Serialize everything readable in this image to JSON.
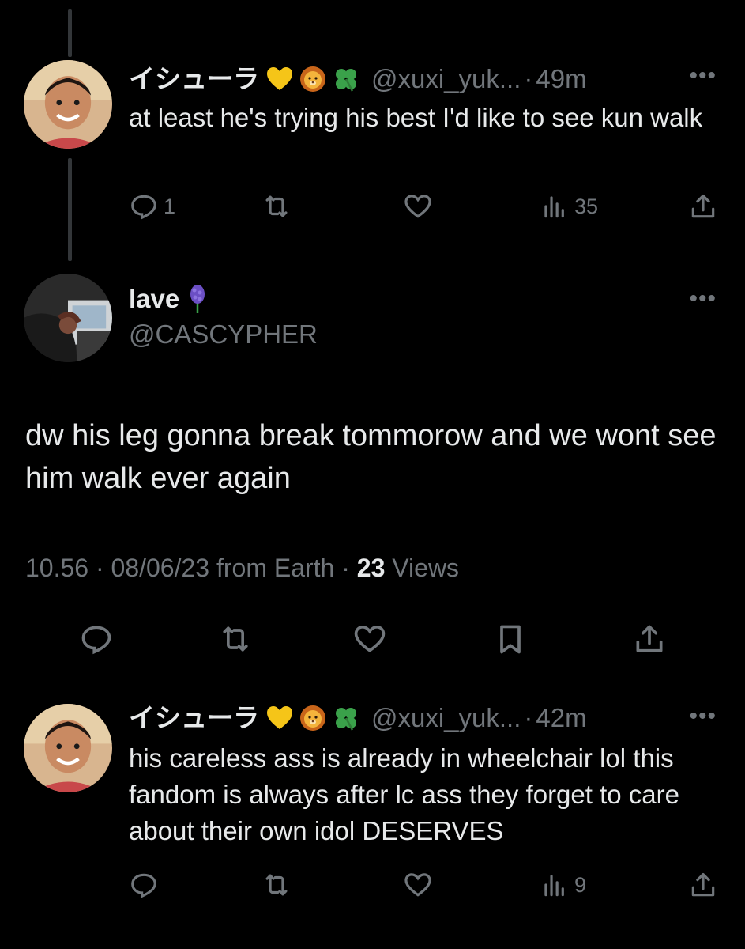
{
  "replies": [
    {
      "display_name": "イシューラ",
      "handle": "@xuxi_yuk...",
      "time": "49m",
      "text": "at least he's trying his best I'd like to see kun walk",
      "reply_count": "1",
      "retweet_count": "",
      "like_count": "",
      "views": "35"
    },
    {
      "display_name": "イシューラ",
      "handle": "@xuxi_yuk...",
      "time": "42m",
      "text": "his careless ass is already in wheelchair lol this fandom is always after lc ass they forget to care about their own idol DESERVES",
      "reply_count": "",
      "retweet_count": "",
      "like_count": "",
      "views": "9"
    }
  ],
  "main_tweet": {
    "display_name": "lave",
    "handle": "@CASCYPHER",
    "text": "dw his leg gonna break tommorow and we wont see him walk ever again",
    "timestamp": "10.56 · 08/06/23 from Earth · ",
    "views_count": "23",
    "views_label": " Views"
  },
  "ui": {
    "separator": "·",
    "more_glyph": "•••"
  },
  "icons": {
    "badges": [
      "yellow-heart-icon",
      "lion-icon",
      "four-leaf-clover-icon"
    ],
    "main_badge": "hyacinth-icon",
    "actions": [
      "reply-icon",
      "retweet-icon",
      "like-icon",
      "views-icon",
      "share-icon"
    ],
    "main_actions": [
      "reply-icon",
      "retweet-icon",
      "like-icon",
      "bookmark-icon",
      "share-icon"
    ]
  },
  "colors": {
    "background": "#000000",
    "text": "#e7e9ea",
    "muted": "#71767b",
    "divider": "#2f3336"
  }
}
